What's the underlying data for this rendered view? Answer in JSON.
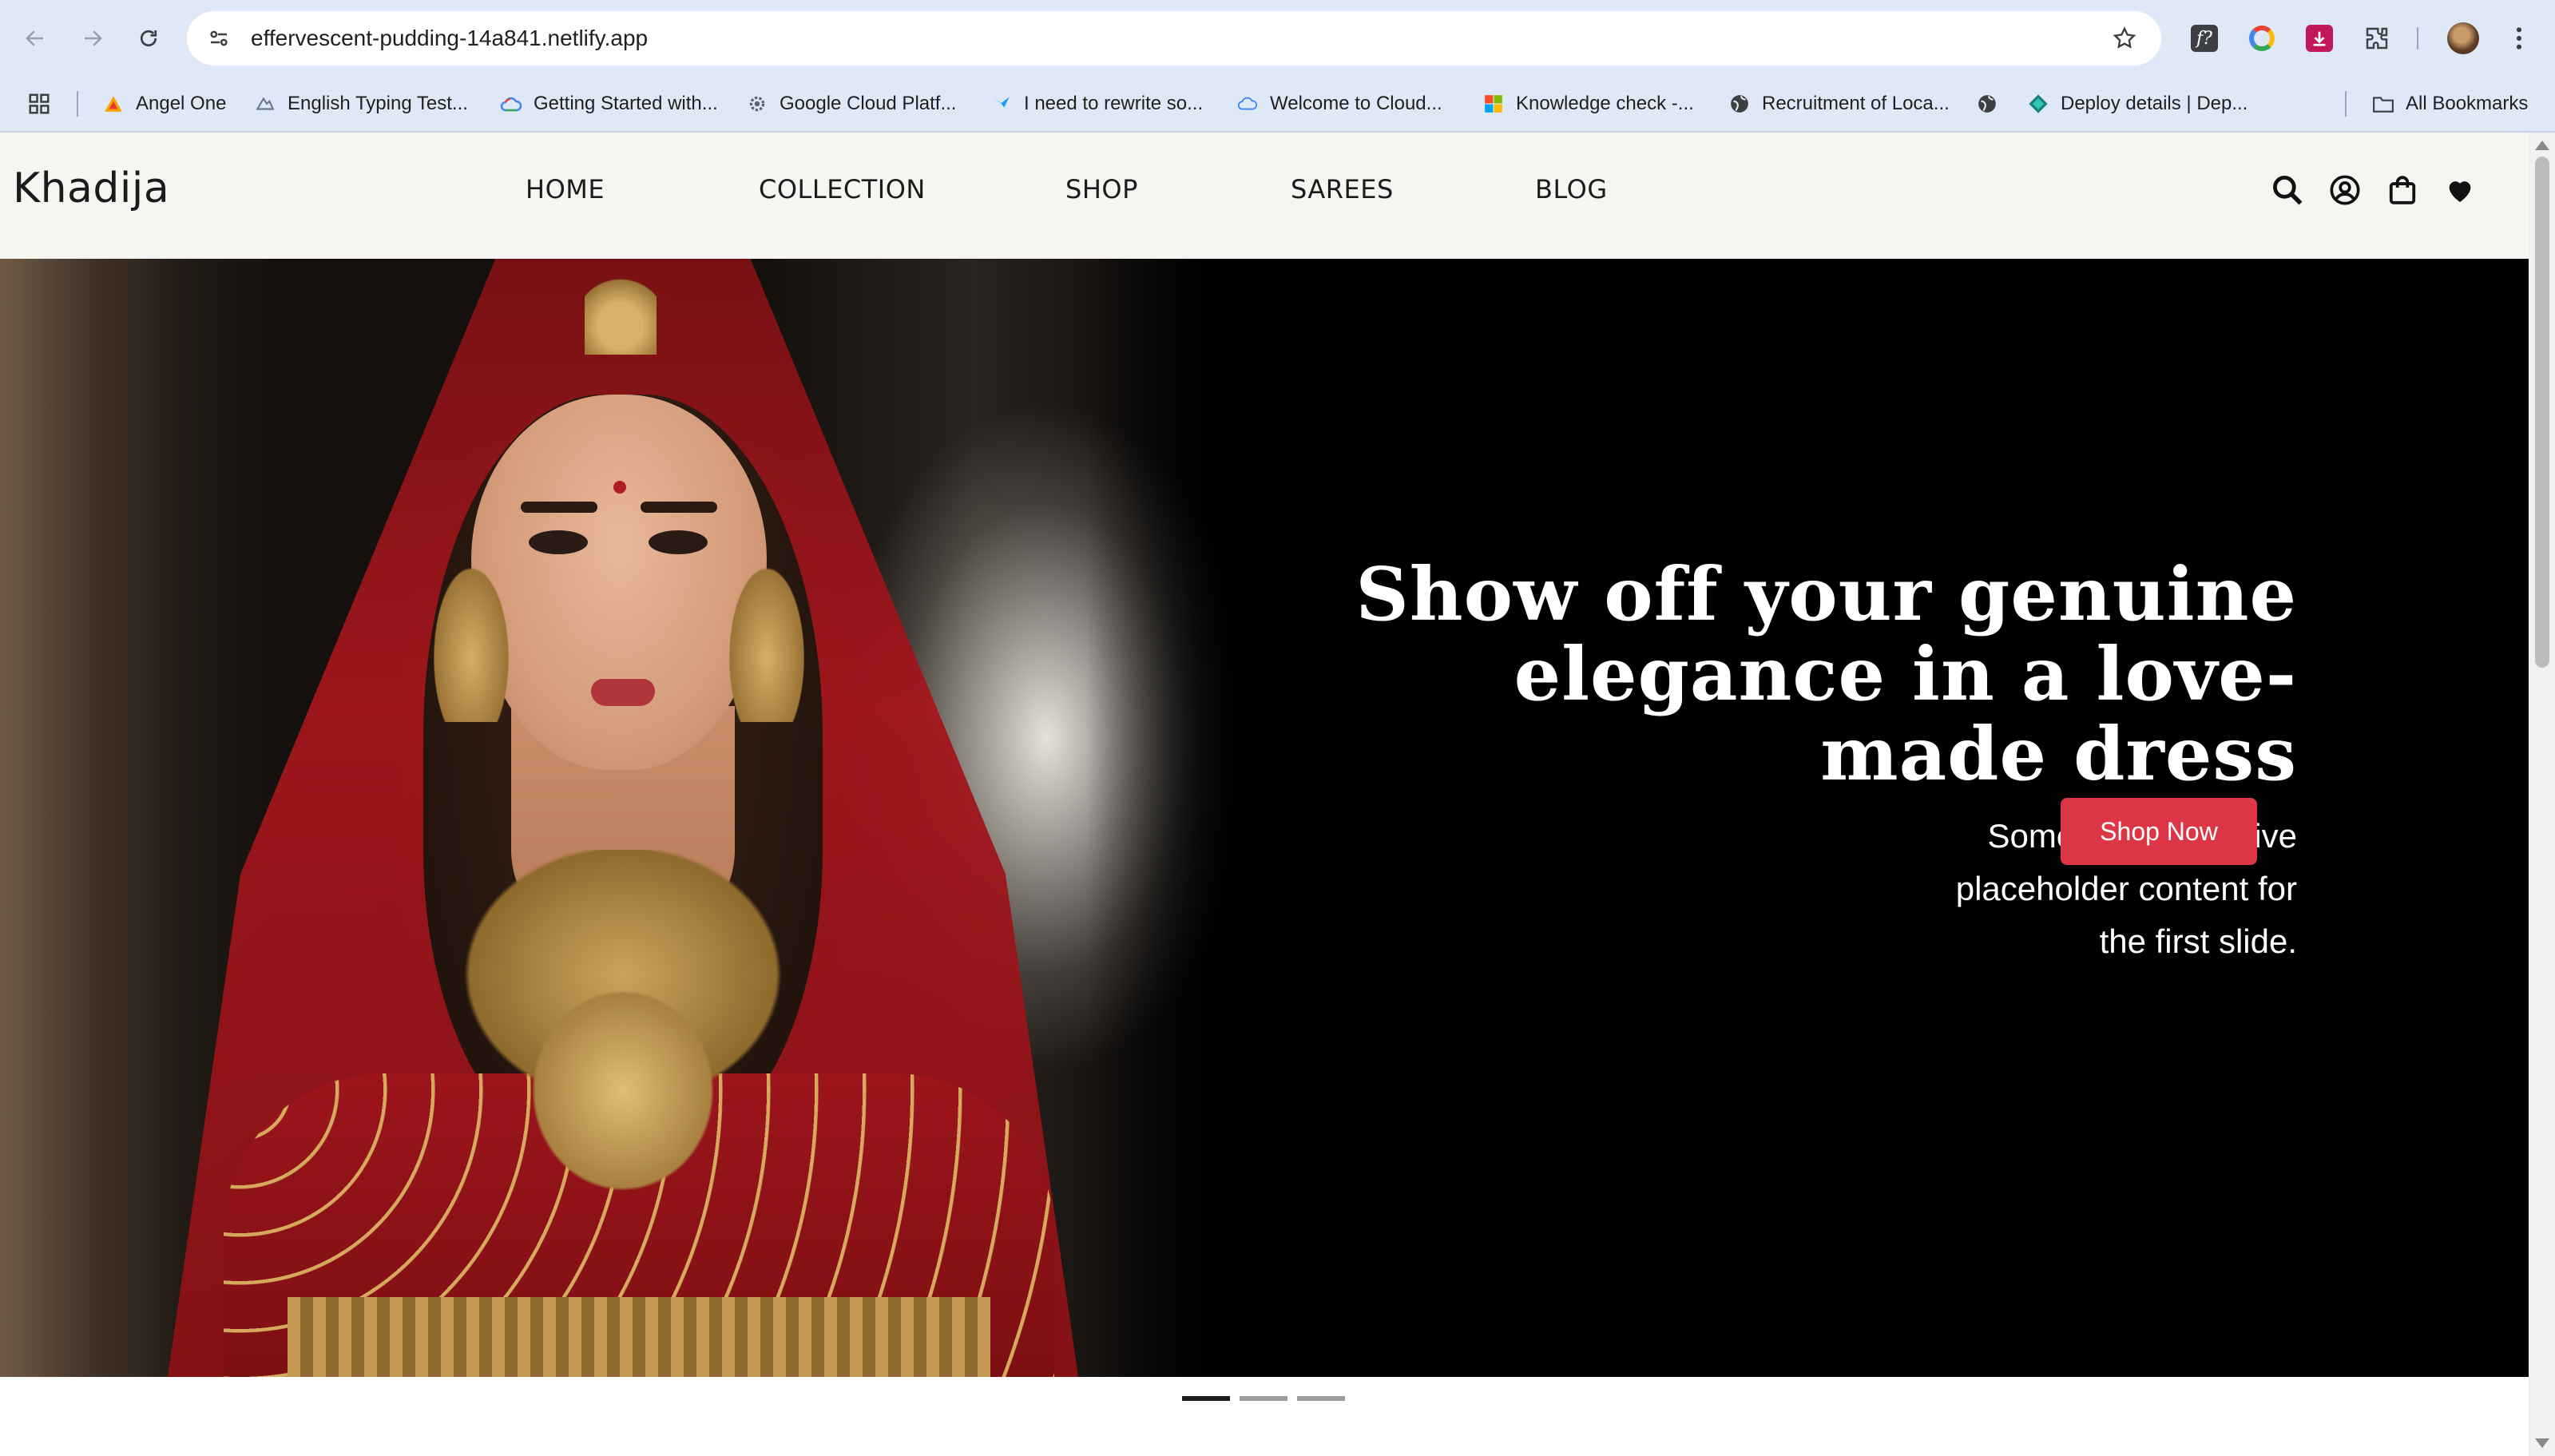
{
  "browser": {
    "url": "effervescent-pudding-14a841.netlify.app",
    "bookmarks": [
      {
        "label": "Angel One",
        "icon": "angel-one-icon"
      },
      {
        "label": "English Typing Test...",
        "icon": "typing-icon"
      },
      {
        "label": "Getting Started with...",
        "icon": "google-cloud-icon"
      },
      {
        "label": "Google Cloud Platf...",
        "icon": "gear-icon"
      },
      {
        "label": "I need to rewrite so...",
        "icon": "bird-icon"
      },
      {
        "label": "Welcome to Cloud...",
        "icon": "cloud-icon"
      },
      {
        "label": "Knowledge check -...",
        "icon": "microsoft-icon"
      },
      {
        "label": "Recruitment of Loca...",
        "icon": "globe-icon"
      },
      {
        "label": "",
        "icon": "globe-icon"
      },
      {
        "label": "Deploy details | Dep...",
        "icon": "netlify-icon"
      }
    ],
    "all_bookmarks_label": "All Bookmarks"
  },
  "site": {
    "brand": "Khadija",
    "menu": [
      "HOME",
      "COLLECTION",
      "SHOP",
      "SAREES",
      "BLOG"
    ],
    "header_icons": [
      "search-icon",
      "user-icon",
      "bag-icon",
      "heart-icon"
    ]
  },
  "hero": {
    "headline_lines": [
      "Show off your genuine",
      "elegance in a love-",
      "made dress"
    ],
    "subtext_lines": [
      "Some representative",
      "placeholder content for",
      "the first slide."
    ],
    "cta_label": "Shop Now",
    "slide_count": 3,
    "active_slide": 1
  },
  "colors": {
    "chrome": "#dfe8f7",
    "header_bg": "#f6f5f1",
    "cta": "#dc3545",
    "hero_bg": "#000000"
  }
}
